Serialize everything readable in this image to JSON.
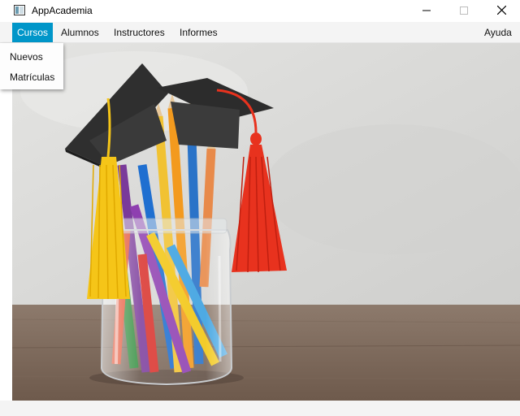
{
  "window": {
    "title": "AppAcademia",
    "icons": {
      "app": "app-window-icon",
      "minimize": "minimize-icon",
      "maximize": "maximize-icon",
      "close": "close-icon"
    }
  },
  "menubar": {
    "items": [
      {
        "label": "Cursos",
        "active": true
      },
      {
        "label": "Alumnos",
        "active": false
      },
      {
        "label": "Instructores",
        "active": false
      },
      {
        "label": "Informes",
        "active": false
      },
      {
        "label": "Ayuda",
        "active": false
      }
    ]
  },
  "dropdown": {
    "items": [
      {
        "label": "Nuevos"
      },
      {
        "label": "Matrículas"
      }
    ]
  },
  "content": {
    "image_subject": "graduation caps on a glass jar of colored pencils"
  },
  "colors": {
    "accent": "#0096c9",
    "menubar_bg": "#f4f4f4",
    "tassel_yellow": "#f5c518",
    "tassel_red": "#e8321e"
  }
}
